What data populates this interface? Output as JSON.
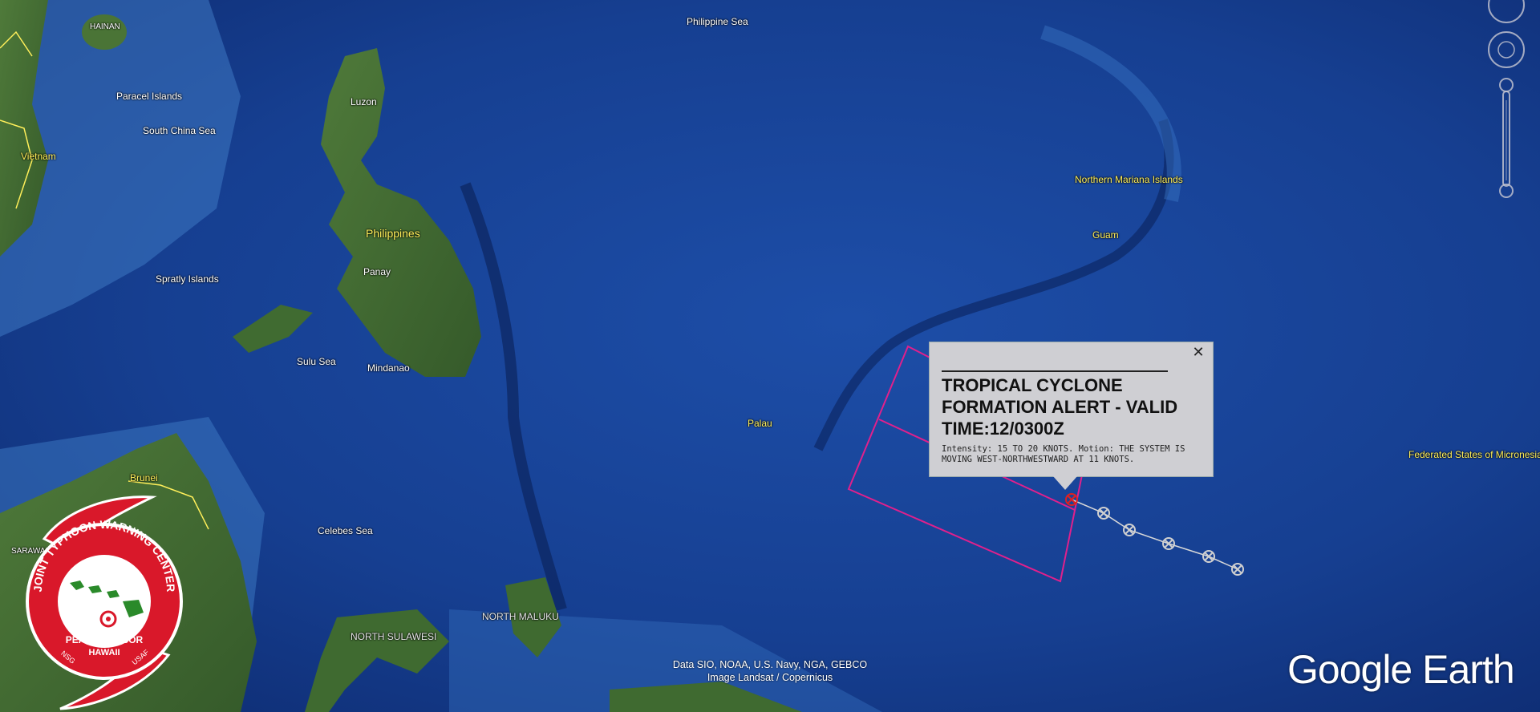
{
  "map_labels": {
    "hainan": "HAINAN",
    "paracel": "Paracel Islands",
    "south_china_sea": "South China Sea",
    "vietnam": "Vietnam",
    "philippine_sea": "Philippine Sea",
    "luzon": "Luzon",
    "philippines": "Philippines",
    "panay": "Panay",
    "spratly": "Spratly Islands",
    "sulu_sea": "Sulu Sea",
    "mindanao": "Mindanao",
    "palau": "Palau",
    "northern_mariana": "Northern Mariana Islands",
    "guam": "Guam",
    "micronesia": "Federated States of Micronesia",
    "brunei": "Brunei",
    "sarawak": "SARAWAK",
    "celebes_sea": "Celebes Sea",
    "north_maluku": "NORTH MALUKU",
    "north_sulawesi": "NORTH SULAWESI"
  },
  "popup": {
    "title": "TROPICAL CYCLONE FORMATION ALERT - VALID TIME:12/0300Z",
    "body": "Intensity: 15 TO 20 KNOTS. Motion: THE SYSTEM IS MOVING WEST-NORTHWESTWARD AT 11 KNOTS.",
    "close": "✕"
  },
  "attribution": {
    "line1": "Data SIO, NOAA, U.S. Navy, NGA, GEBCO",
    "line2": "Image Landsat / Copernicus"
  },
  "brand": "Google Earth",
  "jtwc_logo": {
    "ring_text": "JOINT TYPHOON WARNING CENTER",
    "location": "PEARL HARBOR",
    "state": "HAWAII",
    "n_label": "NSG",
    "s_label": "USAF"
  },
  "colors": {
    "alert_box": "#e0208c",
    "track": "#d8d8d8",
    "logo_red": "#d9182a"
  },
  "icons": {
    "track_point": "circle-x-icon",
    "close": "close-icon",
    "compass": "compass-icon",
    "zoom": "zoom-slider-icon"
  }
}
